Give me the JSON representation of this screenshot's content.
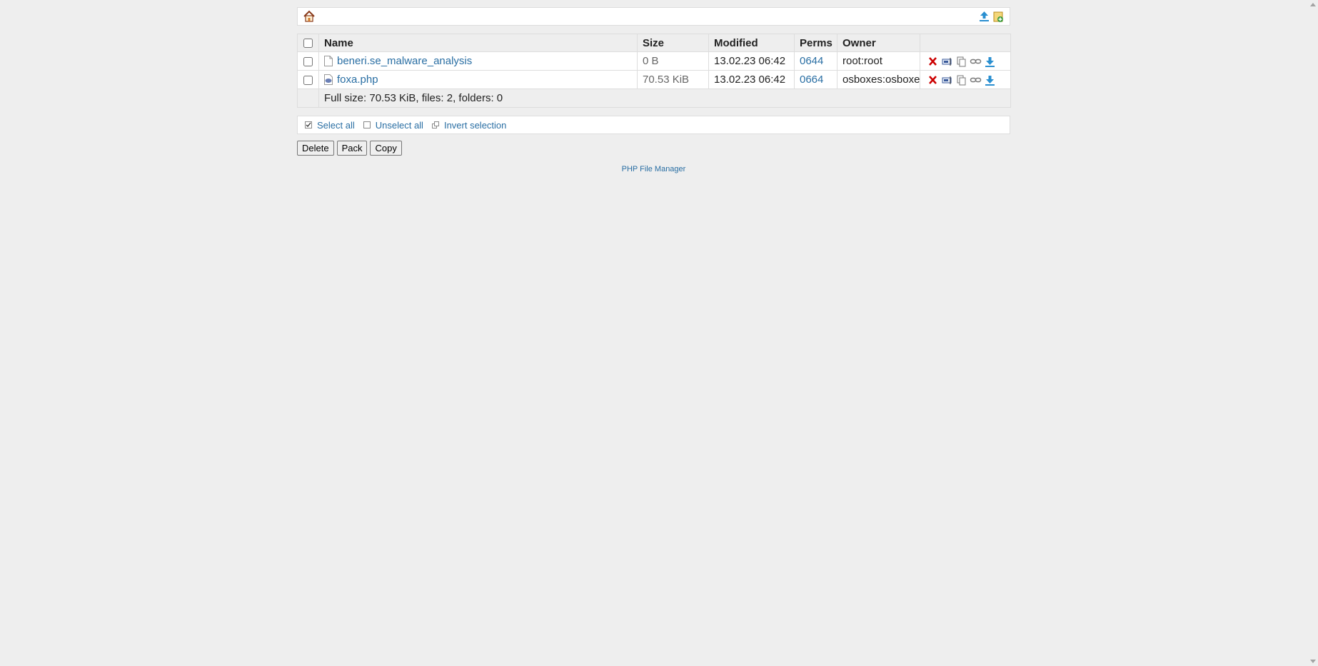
{
  "toolbar": {
    "home_icon": "home-icon",
    "upload_icon": "upload-icon",
    "new_item_icon": "new-folder-icon"
  },
  "table": {
    "headers": {
      "name": "Name",
      "size": "Size",
      "modified": "Modified",
      "perms": "Perms",
      "owner": "Owner"
    },
    "rows": [
      {
        "name": "beneri.se_malware_analysis",
        "icon": "file-icon",
        "size": "0 B",
        "modified": "13.02.23 06:42",
        "perms": "0644",
        "owner": "root:root"
      },
      {
        "name": "foxa.php",
        "icon": "php-file-icon",
        "size": "70.53 KiB",
        "modified": "13.02.23 06:42",
        "perms": "0664",
        "owner": "osboxes:osboxes"
      }
    ],
    "footer": "Full size: 70.53 KiB, files: 2, folders: 0",
    "row_actions": [
      "delete-icon",
      "rename-icon",
      "copy-icon",
      "link-icon",
      "download-icon"
    ]
  },
  "selection": {
    "select_all": "Select all",
    "unselect_all": "Unselect all",
    "invert": "Invert selection"
  },
  "buttons": {
    "delete": "Delete",
    "pack": "Pack",
    "copy": "Copy"
  },
  "footer_link": "PHP File Manager",
  "colors": {
    "link": "#296ea3",
    "background": "#eeeeee",
    "delete_red": "#cc0000"
  }
}
